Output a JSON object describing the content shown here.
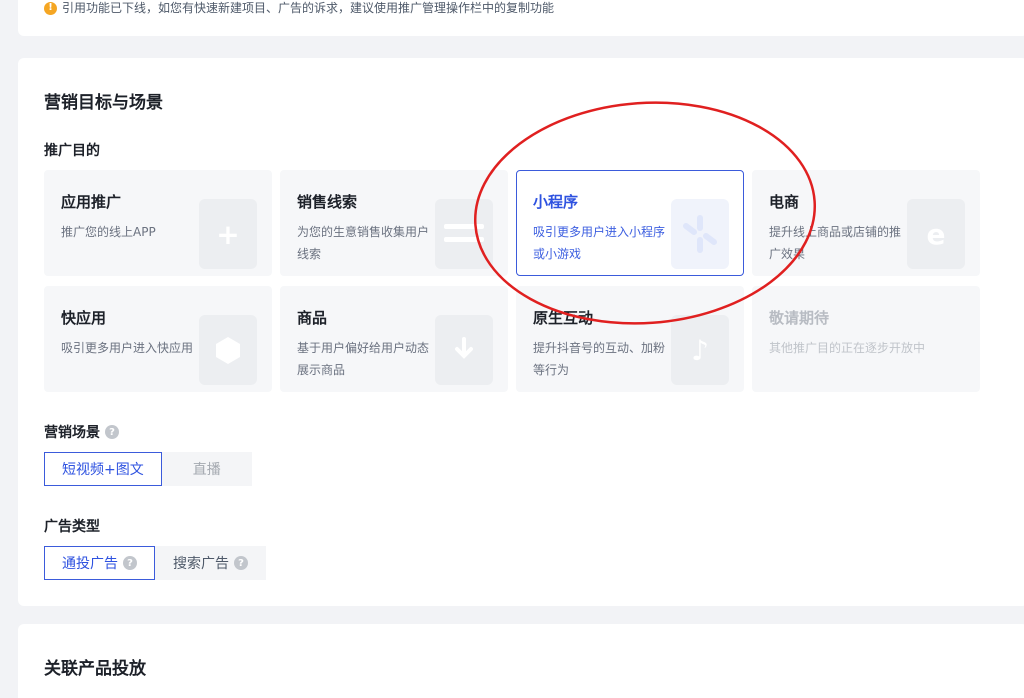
{
  "notice": {
    "text": "引用功能已下线，如您有快速新建项目、广告的诉求，建议使用推广管理操作栏中的复制功能"
  },
  "marketing": {
    "title": "营销目标与场景",
    "goal_label": "推广目的",
    "goals": [
      {
        "title": "应用推广",
        "desc": "推广您的线上APP",
        "icon": "plus-icon",
        "state": "normal"
      },
      {
        "title": "销售线索",
        "desc": "为您的生意销售收集用户线索",
        "icon": "form-icon",
        "state": "normal"
      },
      {
        "title": "小程序",
        "desc": "吸引更多用户进入小程序或小游戏",
        "icon": "miniprogram-icon",
        "state": "selected"
      },
      {
        "title": "电商",
        "desc": "提升线上商品或店铺的推广效果",
        "icon": "shopping-bag-icon",
        "state": "normal"
      },
      {
        "title": "快应用",
        "desc": "吸引更多用户进入快应用",
        "icon": "cube-icon",
        "state": "normal"
      },
      {
        "title": "商品",
        "desc": "基于用户偏好给用户动态展示商品",
        "icon": "cart-icon",
        "state": "normal"
      },
      {
        "title": "原生互动",
        "desc": "提升抖音号的互动、加粉等行为",
        "icon": "douyin-icon",
        "state": "normal"
      },
      {
        "title": "敬请期待",
        "desc": "其他推广目的正在逐步开放中",
        "icon": "",
        "state": "disabled"
      }
    ],
    "scene_label": "营销场景",
    "scenes": [
      {
        "label": "短视频+图文",
        "active": true
      },
      {
        "label": "直播",
        "active": false
      }
    ],
    "adtype_label": "广告类型",
    "adtypes": [
      {
        "label": "通投广告",
        "active": true
      },
      {
        "label": "搜索广告",
        "active": false
      }
    ]
  },
  "product": {
    "title": "关联产品投放"
  },
  "colors": {
    "accent": "#2e52e0",
    "annotation": "#e02020",
    "warning": "#f5a623"
  }
}
